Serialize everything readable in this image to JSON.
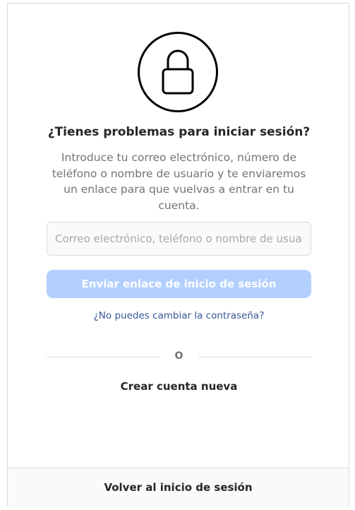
{
  "icons": {
    "lock": "lock-icon"
  },
  "header": {
    "title": "¿Tienes problemas para iniciar sesión?",
    "description": "Introduce tu correo electrónico, número de teléfono o nombre de usuario y te enviaremos un enlace para que vuelvas a entrar en tu cuenta."
  },
  "form": {
    "identifier_placeholder": "Correo electrónico, teléfono o nombre de usuario",
    "identifier_value": "",
    "send_label": "Enviar enlace de inicio de sesión",
    "reset_link": "¿No puedes cambiar la contraseña?"
  },
  "divider": {
    "text": "O"
  },
  "actions": {
    "create_account": "Crear cuenta nueva",
    "back_to_login": "Volver al inicio de sesión"
  },
  "colors": {
    "primary_button_disabled": "#b2cffe",
    "link": "#385898",
    "border": "#dbdbdb",
    "text_primary": "#262626",
    "text_secondary": "#737373"
  }
}
